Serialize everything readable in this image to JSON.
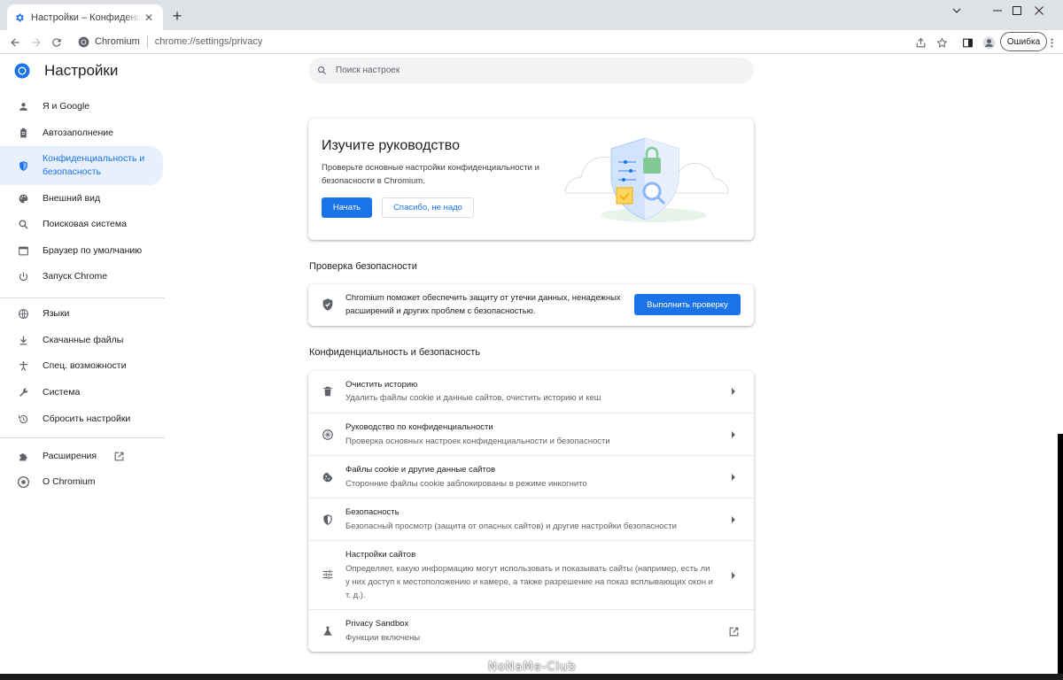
{
  "browser": {
    "tab_title": "Настройки – Конфиденциальность и безопасность",
    "tab_close": "✕",
    "new_tab": "+",
    "site_name": "Chromium",
    "url": "chrome://settings/privacy",
    "profile_error_label": "Ошибка",
    "window_controls": [
      "chevron-down-icon",
      "minimize-icon",
      "maximize-icon",
      "close-icon"
    ]
  },
  "settings": {
    "title": "Настройки",
    "search_placeholder": "Поиск настроек"
  },
  "sidebar": {
    "items": [
      {
        "label": "Я и Google",
        "icon": "person-icon"
      },
      {
        "label": "Автозаполнение",
        "icon": "clipboard-icon"
      },
      {
        "label": "Конфиденциальность и безопасность",
        "icon": "shield-icon",
        "active": true
      },
      {
        "label": "Внешний вид",
        "icon": "palette-icon"
      },
      {
        "label": "Поисковая система",
        "icon": "search-icon"
      },
      {
        "label": "Браузер по умолчанию",
        "icon": "browser-icon"
      },
      {
        "label": "Запуск Chrome",
        "icon": "power-icon"
      },
      {
        "label": "Языки",
        "icon": "globe-icon"
      },
      {
        "label": "Скачанные файлы",
        "icon": "download-icon"
      },
      {
        "label": "Спец. возможности",
        "icon": "accessibility-icon"
      },
      {
        "label": "Система",
        "icon": "wrench-icon"
      },
      {
        "label": "Сбросить настройки",
        "icon": "history-icon"
      },
      {
        "label": "Расширения",
        "icon": "puzzle-icon"
      },
      {
        "label": "О Chromium",
        "icon": "chromium-icon"
      }
    ]
  },
  "promo": {
    "title": "Изучите руководство",
    "description": "Проверьте основные настройки конфиденциальности и безопасности в Chromium.",
    "start_label": "Начать",
    "dismiss_label": "Спасибо, не надо"
  },
  "safety_check": {
    "heading": "Проверка безопасности",
    "text": "Chromium поможет обеспечить защиту от утечки данных, ненадежных расширений и других проблем с безопасностью.",
    "button_label": "Выполнить проверку"
  },
  "privacy": {
    "heading": "Конфиденциальность и безопасность",
    "rows": [
      {
        "title": "Очистить историю",
        "subtitle": "Удалить файлы cookie и данные сайтов, очистить историю и кеш",
        "icon": "trash-icon"
      },
      {
        "title": "Руководство по конфиденциальности",
        "subtitle": "Проверка основных настроек конфиденциальности и безопасности",
        "icon": "compass-icon"
      },
      {
        "title": "Файлы cookie и другие данные сайтов",
        "subtitle": "Сторонние файлы cookie заблокированы в режиме инкогнито",
        "icon": "cookie-icon"
      },
      {
        "title": "Безопасность",
        "subtitle": "Безопасный просмотр (защита от опасных сайтов) и другие настройки безопасности",
        "icon": "shield-icon"
      },
      {
        "title": "Настройки сайтов",
        "subtitle": "Определяет, какую информацию могут использовать и показывать сайты (например, есть ли у них доступ к местоположению и камере, а также разрешение на показ всплывающих окон и т. д.).",
        "icon": "tune-icon"
      },
      {
        "title": "Privacy Sandbox",
        "subtitle": "Функции включены",
        "icon": "flask-icon"
      }
    ]
  },
  "watermark": "NoNaMe-Club",
  "colors": {
    "accent": "#1a73e8",
    "active_nav_bg": "#e8f0fe",
    "titlebar_bg": "#dee1e6"
  }
}
